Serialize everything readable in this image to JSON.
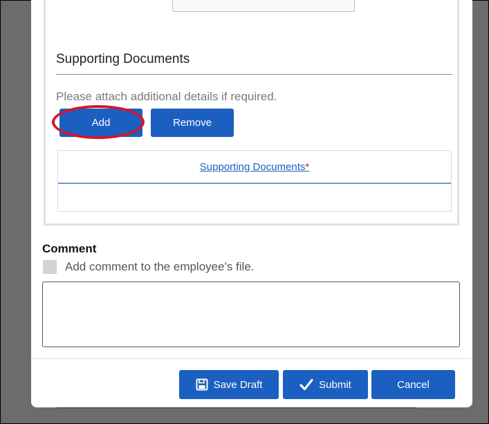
{
  "supporting_documents": {
    "title": "Supporting Documents",
    "hint": "Please attach additional details if required.",
    "add_label": "Add",
    "remove_label": "Remove",
    "table_header": "Supporting Documents",
    "required_marker": "*"
  },
  "comment": {
    "label": "Comment",
    "checkbox_label": "Add comment to the employee's file.",
    "checkbox_checked": false,
    "value": ""
  },
  "footer": {
    "save_draft_label": "Save Draft",
    "submit_label": "Submit",
    "cancel_label": "Cancel"
  },
  "colors": {
    "primary_button": "#1b5fc0",
    "highlight": "#d3162b",
    "required": "#d3162b"
  },
  "icons": {
    "save": "floppy-disk-icon",
    "submit": "checkmark-icon"
  }
}
